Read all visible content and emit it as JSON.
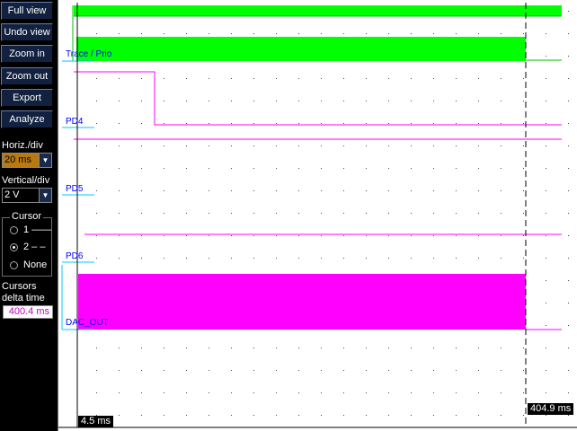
{
  "toolbar": {
    "full_view": "Full view",
    "undo_view": "Undo view",
    "zoom_in": "Zoom in",
    "zoom_out": "Zoom out",
    "export": "Export",
    "analyze": "Analyze"
  },
  "horiz": {
    "label": "Horiz./div",
    "value": "20 ms"
  },
  "vertical": {
    "label": "Vertical/div",
    "value": "2 V"
  },
  "cursor": {
    "title": "Cursor",
    "options": [
      "1 ——",
      "2 – –",
      "None"
    ],
    "selected_index": 1
  },
  "delta": {
    "label_line1": "Cursors",
    "label_line2": "delta time",
    "value": "400.4 ms"
  },
  "traces": [
    {
      "name": "Trace / Prio",
      "color": "#00ff00"
    },
    {
      "name": "PD4",
      "color": "#ff00ff"
    },
    {
      "name": "PD5",
      "color": "#ff00ff"
    },
    {
      "name": "PD6",
      "color": "#ff00ff"
    },
    {
      "name": "DAC_OUT",
      "color": "#ff00ff"
    }
  ],
  "cursors": {
    "c1_readout": "4.5 ms",
    "c2_readout": "404.9 ms"
  },
  "colors": {
    "background": "#ffffff",
    "sidebar_bg": "#000000",
    "button_bg": "#12213f",
    "label_text": "#0000ff",
    "axis": "#00c8ff",
    "highlight": "#b77a12"
  }
}
